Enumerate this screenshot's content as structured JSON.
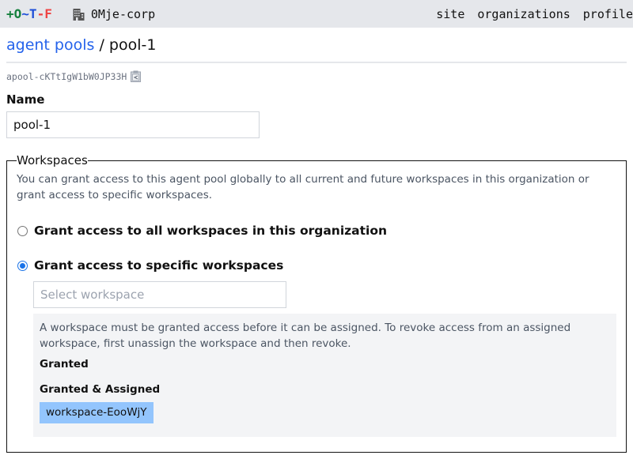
{
  "topbar": {
    "logo": {
      "plus": "+",
      "o": "O",
      "tilde": "~",
      "t": "T",
      "dash": "-",
      "f": "F"
    },
    "organization": {
      "icon": "building-icon",
      "name": "0Mje-corp"
    },
    "nav": [
      {
        "label": "site"
      },
      {
        "label": "organizations"
      },
      {
        "label": "profile"
      }
    ]
  },
  "breadcrumb": {
    "parent": "agent pools",
    "separator": " / ",
    "current": "pool-1"
  },
  "resource": {
    "id": "apool-cKTtIgW1bW0JP33H",
    "copy_icon": "clipboard-icon"
  },
  "name_field": {
    "label": "Name",
    "value": "pool-1"
  },
  "workspaces": {
    "legend": "Workspaces",
    "help": "You can grant access to this agent pool globally to all current and future workspaces in this organization or grant access to specific workspaces.",
    "options": [
      {
        "label": "Grant access to all workspaces in this organization",
        "checked": false
      },
      {
        "label": "Grant access to specific workspaces",
        "checked": true
      }
    ],
    "select_placeholder": "Select workspace",
    "panel": {
      "help": "A workspace must be granted access before it can be assigned. To revoke access from an assigned workspace, first unassign the workspace and then revoke.",
      "granted_heading": "Granted",
      "granted_items": [],
      "assigned_heading": "Granted & Assigned",
      "assigned_items": [
        {
          "name": "workspace-EooWjY"
        }
      ]
    }
  },
  "colors": {
    "link": "#2563eb",
    "topbar_bg": "#e5e7eb",
    "tag_bg": "#93c5fd",
    "panel_bg": "#f3f4f6"
  }
}
